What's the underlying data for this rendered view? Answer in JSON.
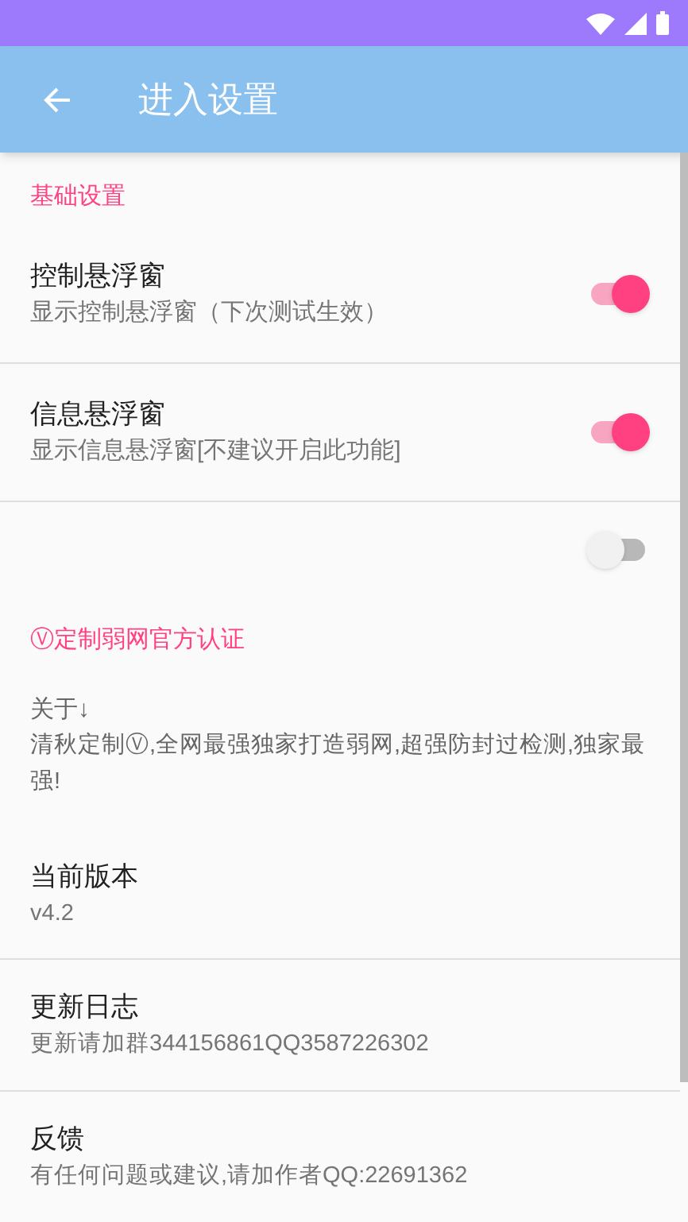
{
  "toolbar": {
    "title": "进入设置"
  },
  "items": [
    {
      "kind": "category",
      "title": "基础设置"
    },
    {
      "kind": "switch",
      "title": "控制悬浮窗",
      "summary": "显示控制悬浮窗（下次测试生效）",
      "on": true
    },
    {
      "kind": "switch",
      "title": "信息悬浮窗",
      "summary": "显示信息悬浮窗[不建议开启此功能]",
      "on": true
    },
    {
      "kind": "switch",
      "on": false
    },
    {
      "kind": "category",
      "title": "Ⓥ定制弱网官方认证"
    },
    {
      "kind": "text",
      "title": "关于↓",
      "summary": "清秋定制Ⓥ,全网最强独家打造弱网,超强防封过检测,独家最强!"
    },
    {
      "kind": "preference",
      "title": "当前版本",
      "summary": "v4.2"
    },
    {
      "kind": "preference",
      "title": "更新日志",
      "summary": "更新请加群344156861QQ3587226302"
    },
    {
      "kind": "preference",
      "title": "反馈",
      "summary": "有任何问题或建议,请加作者QQ:22691362"
    }
  ]
}
